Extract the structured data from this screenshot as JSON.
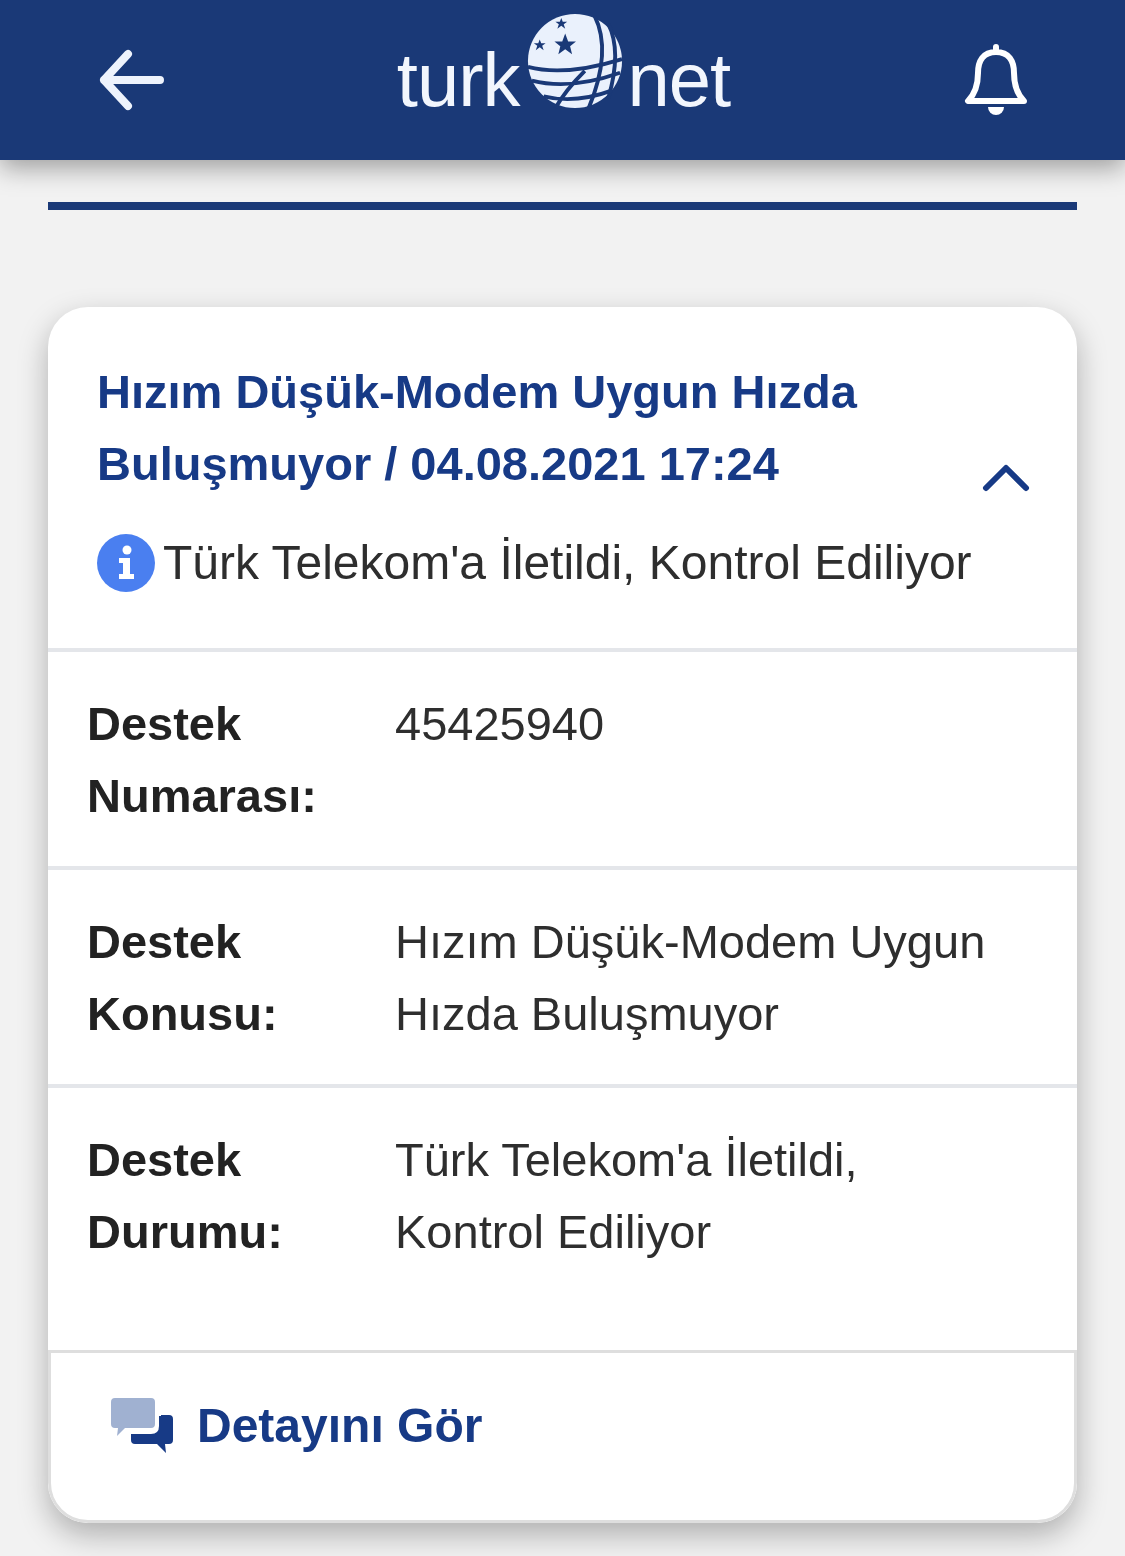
{
  "header": {
    "logo_left": "turk",
    "logo_right": "net"
  },
  "ticket": {
    "title": "Hızım Düşük-Modem Uygun Hızda Buluşmuyor / 04.08.2021 17:24",
    "expanded": true,
    "status": "Türk Telekom'a İletildi, Kontrol Ediliyor",
    "details": [
      {
        "label": "Destek Numarası:",
        "value": "45425940"
      },
      {
        "label": "Destek Konusu:",
        "value": "Hızım Düşük-Modem Uygun Hızda Buluşmuyor"
      },
      {
        "label": "Destek Durumu:",
        "value": "Türk Telekom'a İletildi, Kontrol Ediliyor"
      }
    ],
    "detail_button": "Detayını Gör"
  }
}
